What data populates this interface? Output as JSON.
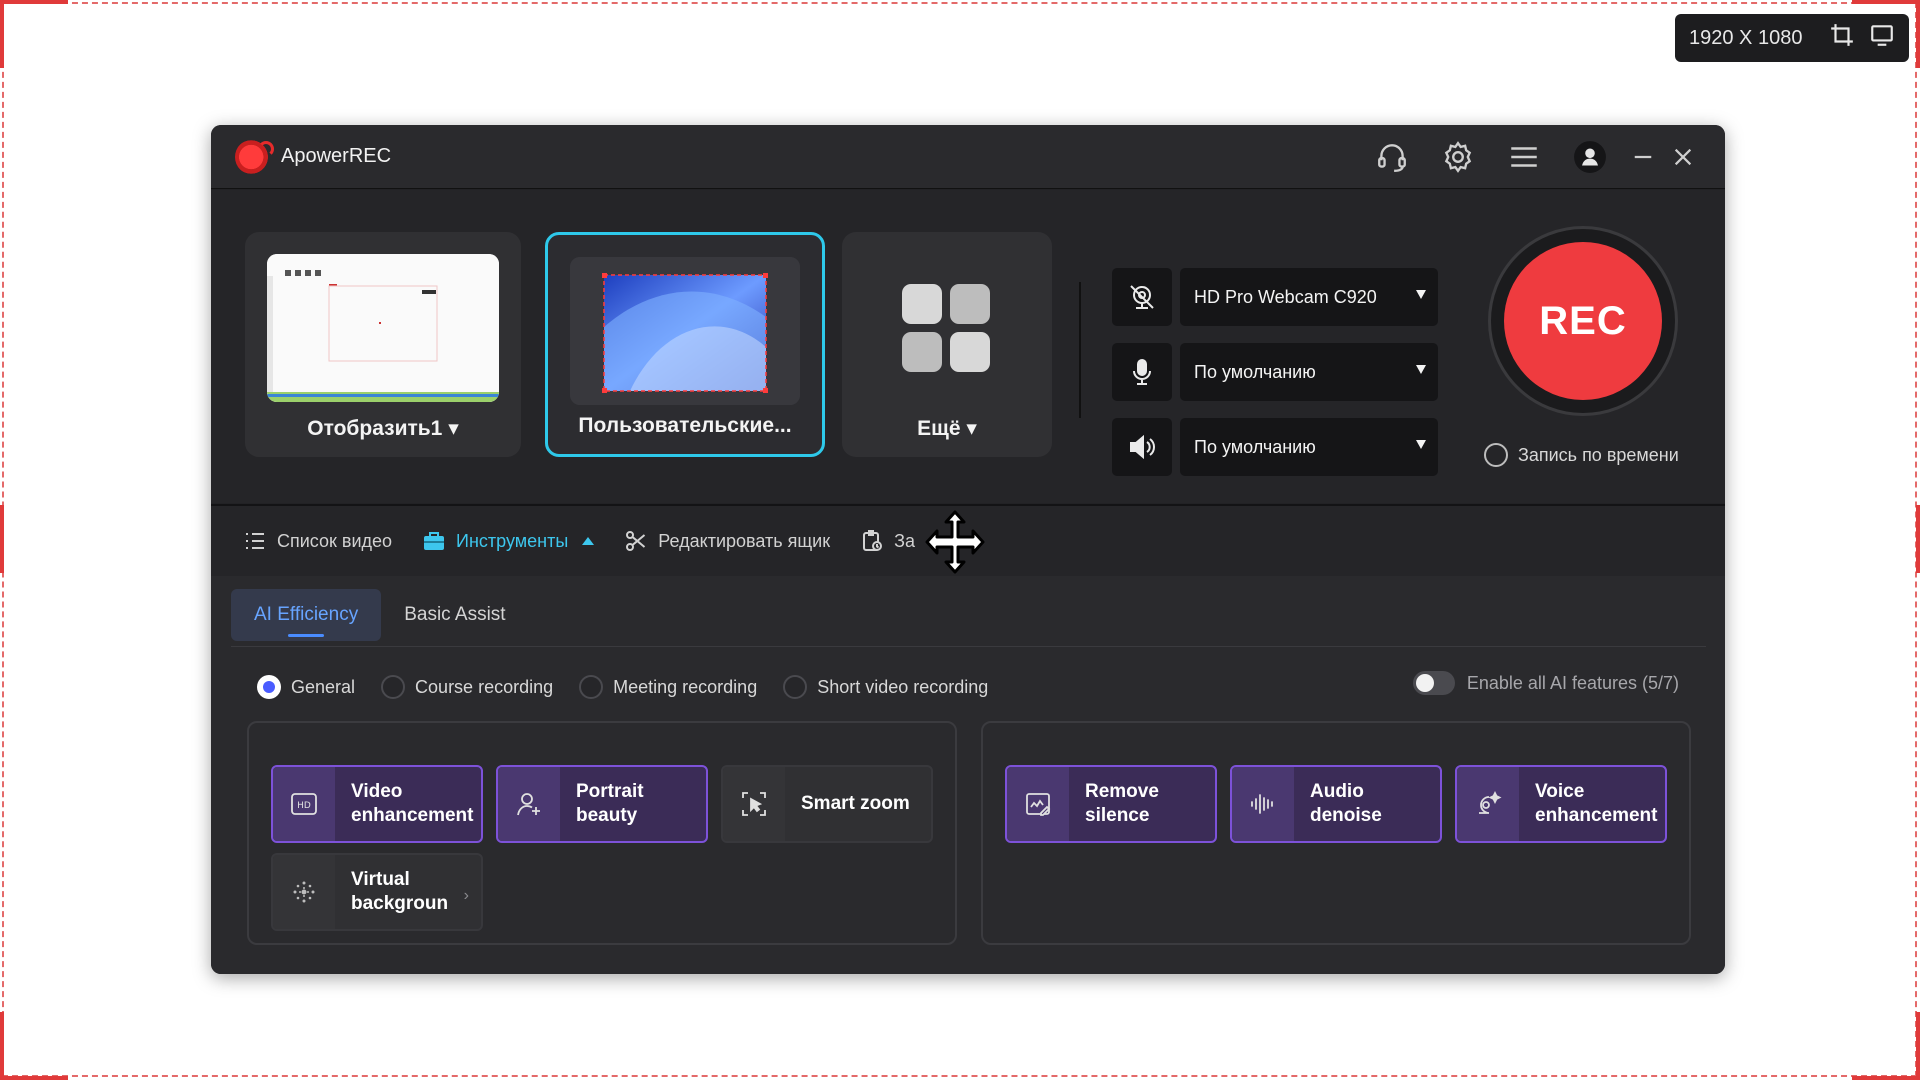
{
  "overlay": {
    "resolution_text": "1920 X 1080",
    "accent_color": "#e03a3a"
  },
  "app": {
    "title": "ApowerREC",
    "icons": [
      "headset-icon",
      "gear-icon",
      "menu-icon",
      "user-icon",
      "minimize-icon",
      "close-icon"
    ]
  },
  "capture_modes": [
    {
      "label": "Отобразить1 ▾",
      "selected": false
    },
    {
      "label": "Пользовательские...",
      "selected": true
    },
    {
      "label": "Ещё ▾",
      "selected": false
    }
  ],
  "devices": {
    "webcam": "HD Pro Webcam C920",
    "microphone": "По умолчанию",
    "speaker": "По умолчанию"
  },
  "rec": {
    "button_label": "REC",
    "timed_label": "Запись по времени",
    "button_color": "#ef3b3f"
  },
  "nav": {
    "video_list": "Список видео",
    "tools": "Инструменты",
    "edit_box": "Редактировать ящик",
    "tasks_partial": "За"
  },
  "panel": {
    "tabs": [
      {
        "label": "AI Efficiency",
        "active": true
      },
      {
        "label": "Basic Assist",
        "active": false
      }
    ],
    "scenes": [
      {
        "label": "General",
        "selected": true
      },
      {
        "label": "Course recording",
        "selected": false
      },
      {
        "label": "Meeting recording",
        "selected": false
      },
      {
        "label": "Short video recording",
        "selected": false
      }
    ],
    "enable_all": "Enable all AI features (5/7)",
    "features_left": [
      {
        "label": "Video\nenhancement",
        "icon": "hd-icon",
        "enabled": true
      },
      {
        "label": "Portrait\nbeauty",
        "icon": "portrait-icon",
        "enabled": true
      },
      {
        "label": "Smart zoom",
        "icon": "zoom-cursor-icon",
        "enabled": false
      },
      {
        "label": "Virtual\nbackgroun",
        "icon": "sparkle-icon",
        "enabled": false,
        "more": "›"
      }
    ],
    "features_right": [
      {
        "label": "Remove\nsilence",
        "icon": "silence-icon",
        "enabled": true
      },
      {
        "label": "Audio\ndenoise",
        "icon": "waveform-icon",
        "enabled": true
      },
      {
        "label": "Voice\nenhancement",
        "icon": "voice-icon",
        "enabled": true
      }
    ],
    "accent_purple": "#7d52d9",
    "accent_blue": "#3dc7ee"
  }
}
